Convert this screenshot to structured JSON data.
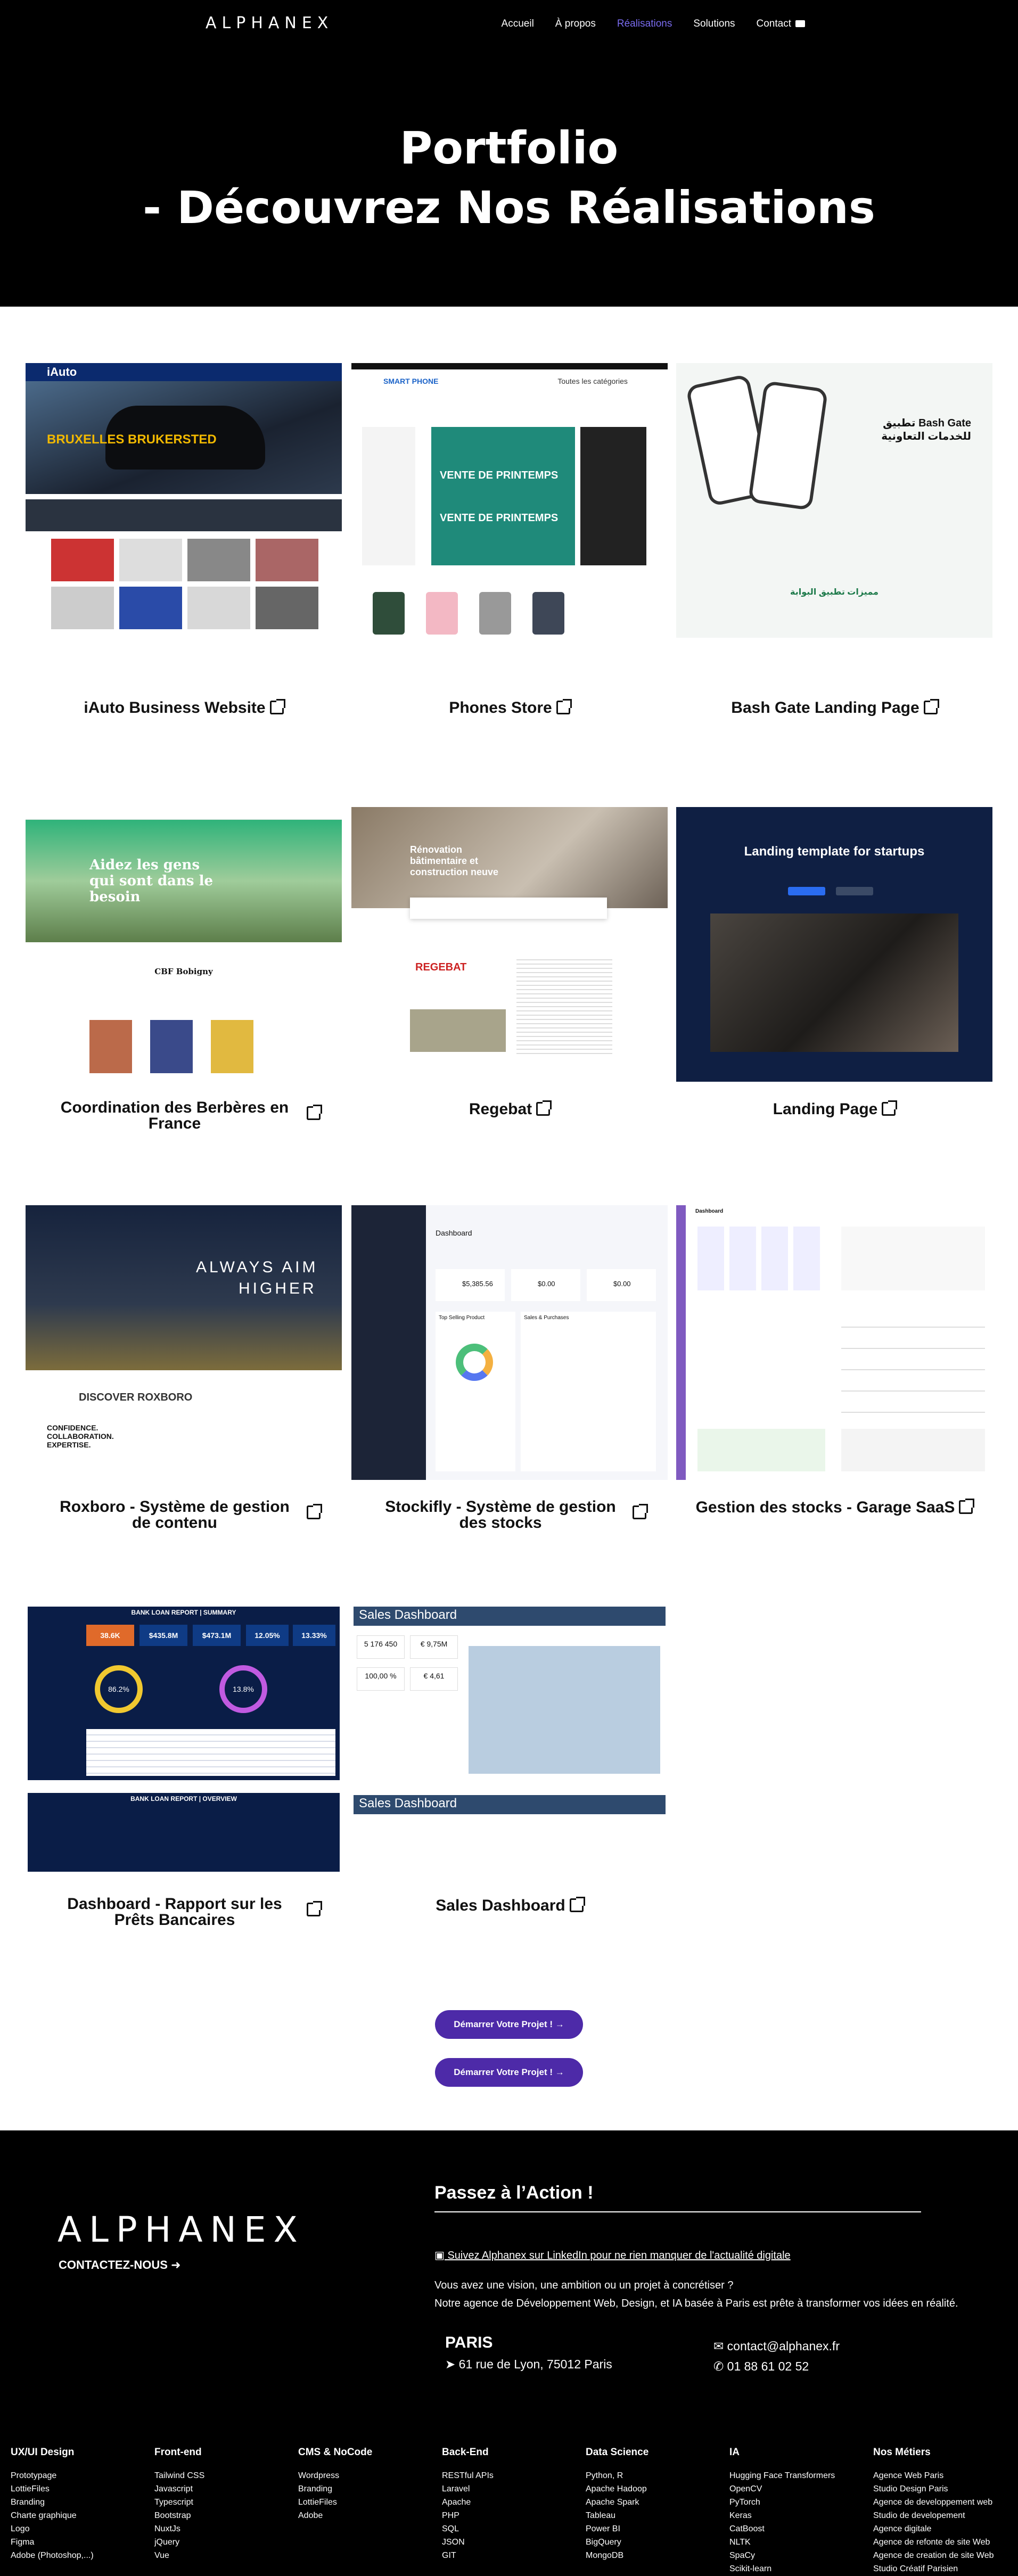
{
  "nav": {
    "logo": "ALPHANEX",
    "items": [
      "Accueil",
      "À propos",
      "Réalisations",
      "Solutions",
      "Contact"
    ]
  },
  "hero": {
    "line1": "Portfolio",
    "line2": "- Découvrez Nos Réalisations"
  },
  "projects": [
    {
      "title": "iAuto Business Website"
    },
    {
      "title": "Phones Store"
    },
    {
      "title": "Bash Gate Landing Page"
    },
    {
      "title": "Coordination des Berbères en France"
    },
    {
      "title": "Regebat"
    },
    {
      "title": "Landing Page"
    },
    {
      "title": "Roxboro - Système de gestion de contenu"
    },
    {
      "title": "Stockifly - Système de gestion des stocks"
    },
    {
      "title": "Gestion des stocks - Garage SaaS"
    },
    {
      "title": "Dashboard - Rapport sur les Prêts Bancaires"
    },
    {
      "title": "Sales Dashboard"
    }
  ],
  "thumbs": {
    "iauto": {
      "brand": "iAuto",
      "head": "BRUXELLES BRUKERSTED"
    },
    "phones": {
      "brand": "SMART PHONE",
      "promo": "VENTE DE PRINTEMPS",
      "search": "Toutes les catégories"
    },
    "bash": {
      "title": "تطبيق Bash Gate للخدمات التعاونية",
      "section": "مميزات تطبيق البوابة"
    },
    "berberes": {
      "title": "Aidez les gens qui sont dans le besoin",
      "org": "CBF Bobigny"
    },
    "regebat": {
      "title": "Rénovation bâtimentaire et construction neuve",
      "brand": "REGEBAT"
    },
    "landing": {
      "title": "Landing template for startups"
    },
    "roxboro": {
      "hero1": "ALWAYS AIM",
      "hero2": "HIGHER",
      "discover": "DISCOVER ROXBORO",
      "tag": "CONFIDENCE. COLLABORATION. EXPERTISE."
    },
    "stockifly": {
      "page": "Dashboard",
      "v1": "$5,385.56",
      "v2": "$0.00",
      "v3": "$0.00",
      "chart": "Sales & Purchases",
      "top": "Top Selling Product"
    },
    "garage": {
      "title": "Dashboard"
    },
    "bank": {
      "title": "BANK LOAN REPORT | SUMMARY",
      "title2": "BANK LOAN REPORT | OVERVIEW",
      "k1": "38.6K",
      "k2": "$435.8M",
      "k3": "$473.1M",
      "k4": "12.05%",
      "k5": "13.33%",
      "gauge1": "86.2%",
      "gauge2": "13.8%"
    },
    "sales": {
      "title": "Sales Dashboard",
      "q": "5 176 450",
      "s": "€ 9,75M",
      "m": "100,00 %",
      "a": "€ 4,61"
    }
  },
  "cta": {
    "label": "Démarrer Votre Projet !"
  },
  "footer": {
    "logo": "ALPHANEX",
    "contact": "CONTACTEZ-NOUS",
    "action": "Passez à l’Action !",
    "linkedin": "Suivez Alphanex sur LinkedIn pour ne rien manquer de l'actualité digitale",
    "vision1": "Vous avez une vision, une ambition ou un projet à concrétiser ?",
    "vision2": "Notre agence de Développement Web, Design, et IA basée à Paris est prête à transformer vos idées en réalité.",
    "city": "PARIS",
    "address": "61 rue de Lyon, 75012 Paris",
    "email": "contact@alphanex.fr",
    "phone": "01 88 61 02 52",
    "columns": [
      {
        "title": "UX/UI Design",
        "items": [
          "Prototypage",
          "LottieFiles",
          "Branding",
          "Charte graphique",
          "Logo",
          "Figma",
          "Adobe (Photoshop,...)"
        ]
      },
      {
        "title": "Front-end",
        "items": [
          "Tailwind CSS",
          "Javascript",
          "Typescript",
          "Bootstrap",
          "NuxtJs",
          "jQuery",
          "Vue"
        ]
      },
      {
        "title": "CMS & NoCode",
        "items": [
          "Wordpress",
          "Branding",
          "LottieFiles",
          "Adobe"
        ]
      },
      {
        "title": "Back-End",
        "items": [
          "RESTful APIs",
          "Laravel",
          "Apache",
          "PHP",
          "SQL",
          "JSON",
          "GIT"
        ]
      },
      {
        "title": "Data Science",
        "items": [
          "Python, R",
          "Apache Hadoop",
          "Apache Spark",
          "Tableau",
          "Power BI",
          "BigQuery",
          "MongoDB"
        ]
      },
      {
        "title": "IA",
        "items": [
          "Hugging Face Transformers",
          "OpenCV",
          "PyTorch",
          "Keras",
          "CatBoost",
          "NLTK",
          "SpaCy",
          "Scikit-learn"
        ]
      },
      {
        "title": "Nos Métiers",
        "items": [
          "Agence Web Paris",
          "Studio Design Paris",
          "Agence de developpement web",
          "Studio de developement",
          "Agence digitale",
          "Agence de refonte de site Web",
          "Agence de creation de site Web",
          "Studio Créatif Parisien"
        ]
      }
    ]
  }
}
